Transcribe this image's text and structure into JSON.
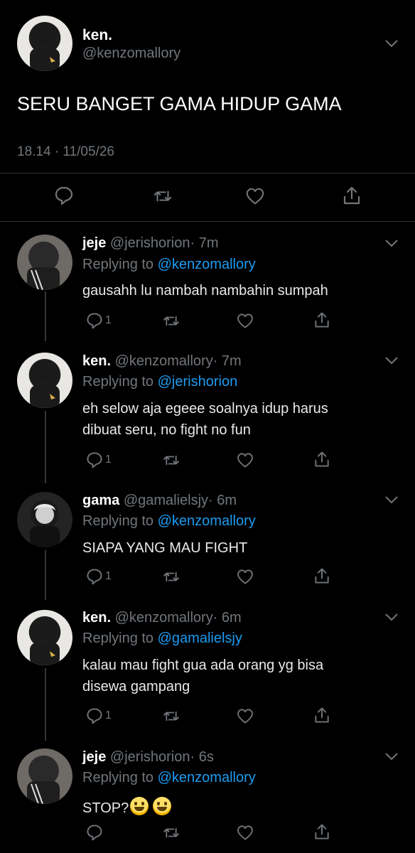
{
  "main_tweet": {
    "name": "ken.",
    "handle": "@kenzomallory",
    "text": "SERU BANGET GAMA HIDUP GAMA",
    "timestamp": "18.14 · 11/05/26"
  },
  "replies": [
    {
      "name": "jeje",
      "handle": "@jerishorion",
      "time": "· 7m",
      "replying_label": "Replying to",
      "replying_to": "@kenzomallory",
      "text_lines": [
        "gausahh lu nambah nambahin sumpah"
      ],
      "reply_count": "1"
    },
    {
      "name": "ken.",
      "handle": "@kenzomallory",
      "time": "· 7m",
      "replying_label": "Replying to",
      "replying_to": "@jerishorion",
      "text_lines": [
        "eh selow aja egeee soalnya idup harus",
        "dibuat seru, no fight no fun"
      ],
      "reply_count": "1"
    },
    {
      "name": "gama",
      "handle": "@gamalielsjy",
      "time": "· 6m",
      "replying_label": "Replying to",
      "replying_to": "@kenzomallory",
      "text_lines": [
        "SIAPA YANG MAU FIGHT"
      ],
      "reply_count": "1"
    },
    {
      "name": "ken.",
      "handle": "@kenzomallory",
      "time": "· 6m",
      "replying_label": "Replying to",
      "replying_to": "@gamalielsjy",
      "text_lines": [
        "kalau mau fight gua ada orang yg bisa",
        "disewa gampang"
      ],
      "reply_count": "1"
    },
    {
      "name": "jeje",
      "handle": "@jerishorion",
      "time": "· 6s",
      "replying_label": "Replying to",
      "replying_to": "@kenzomallory",
      "text_lines": [
        "STOP?"
      ],
      "reply_count": ""
    }
  ],
  "icons": {
    "reply": "reply-icon",
    "retweet": "retweet-icon",
    "like": "heart-icon",
    "share": "share-icon",
    "more": "chevron-down-icon",
    "emoji": "grinning-face-emoji"
  },
  "colors": {
    "background": "#000000",
    "link": "#1d9bf0",
    "muted": "#71767b",
    "text": "#e7e9ea"
  }
}
